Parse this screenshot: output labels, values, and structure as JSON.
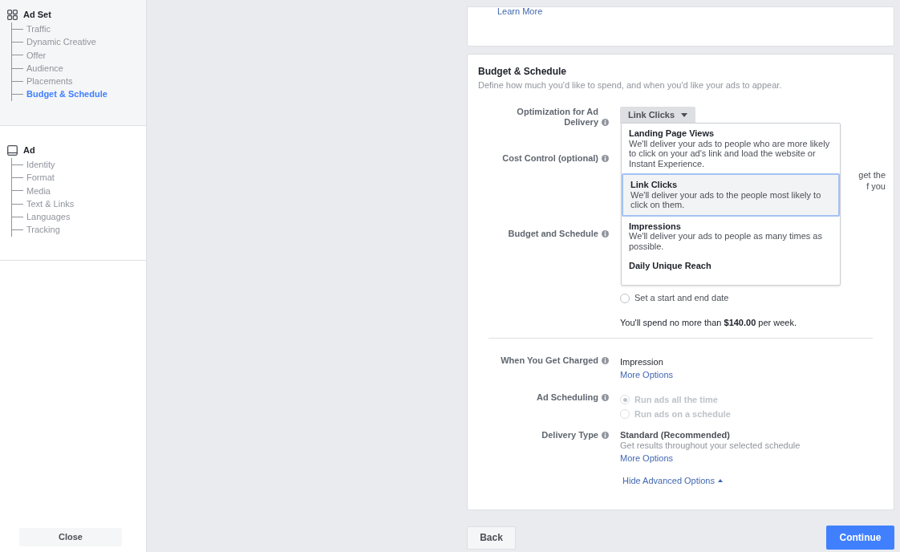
{
  "sidebar": {
    "sections": [
      {
        "title": "Ad Set",
        "kind": "grid",
        "active": true,
        "items": [
          {
            "label": "Traffic",
            "selected": false
          },
          {
            "label": "Dynamic Creative",
            "selected": false
          },
          {
            "label": "Offer",
            "selected": false
          },
          {
            "label": "Audience",
            "selected": false
          },
          {
            "label": "Placements",
            "selected": false
          },
          {
            "label": "Budget & Schedule",
            "selected": true
          }
        ]
      },
      {
        "title": "Ad",
        "kind": "monitor",
        "active": false,
        "items": [
          {
            "label": "Identity",
            "selected": false
          },
          {
            "label": "Format",
            "selected": false
          },
          {
            "label": "Media",
            "selected": false
          },
          {
            "label": "Text & Links",
            "selected": false
          },
          {
            "label": "Languages",
            "selected": false
          },
          {
            "label": "Tracking",
            "selected": false
          }
        ]
      }
    ],
    "close_button": "Close"
  },
  "top_card": {
    "link": "Learn More"
  },
  "budget_card": {
    "title": "Budget & Schedule",
    "subtitle": "Define how much you'd like to spend, and when you'd like your ads to appear.",
    "optimization": {
      "label": "Optimization for Ad Delivery",
      "value": "Link Clicks",
      "expanded": true,
      "options": [
        {
          "title": "Landing Page Views",
          "description": "We'll deliver your ads to people who are more likely to click on your ad's link and load the website or Instant Experience.",
          "selected": false
        },
        {
          "title": "Link Clicks",
          "description": "We'll deliver your ads to the people most likely to click on them.",
          "selected": true
        },
        {
          "title": "Impressions",
          "description": "We'll deliver your ads to people as many times as possible.",
          "selected": false
        },
        {
          "title": "Daily Unique Reach",
          "selected": false
        }
      ]
    },
    "cost_control": {
      "label": "Cost Control (optional)",
      "hint_lines": [
        "get the",
        "f you"
      ]
    },
    "budget_schedule": {
      "label": "Budget and Schedule",
      "radios": [
        {
          "label": "Set a start and end date",
          "selected": false,
          "disabled": false
        }
      ],
      "summary": "You'll spend no more than **$140.00** per week."
    },
    "charged": {
      "label": "When You Get Charged",
      "value": "Impression",
      "link": "More Options"
    },
    "ad_scheduling": {
      "label": "Ad Scheduling",
      "radios": [
        {
          "label": "Run ads all the time",
          "selected": true,
          "disabled": true
        },
        {
          "label": "Run ads on a schedule",
          "selected": false,
          "disabled": true
        }
      ]
    },
    "delivery_type": {
      "label": "Delivery Type",
      "value": "Standard (Recommended)",
      "description": "Get results throughout your selected schedule",
      "link": "More Options"
    },
    "advanced_toggle": {
      "label": "Hide Advanced Options",
      "expanded": true
    }
  },
  "footer": {
    "back": "Back",
    "continue": "Continue"
  }
}
